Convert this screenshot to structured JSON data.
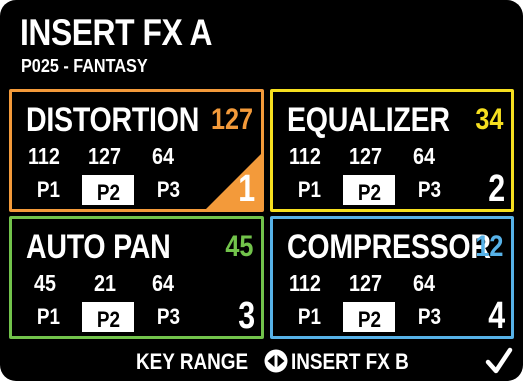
{
  "header": {
    "title": "INSERT FX A",
    "subtitle": "P025 - FANTASY"
  },
  "slots": [
    {
      "name": "DISTORTION",
      "level": "127",
      "params": [
        "112",
        "127",
        "64"
      ],
      "param_labels": [
        "P1",
        "P2",
        "P3"
      ],
      "selected_param": "P2",
      "number": "1",
      "color": "#f39a3a",
      "active": true
    },
    {
      "name": "EQUALIZER",
      "level": "34",
      "params": [
        "112",
        "127",
        "64"
      ],
      "param_labels": [
        "P1",
        "P2",
        "P3"
      ],
      "selected_param": "P2",
      "number": "2",
      "color": "#f6df1f",
      "active": false
    },
    {
      "name": "AUTO PAN",
      "level": "45",
      "params": [
        "45",
        "21",
        "64"
      ],
      "param_labels": [
        "P1",
        "P2",
        "P3"
      ],
      "selected_param": "P2",
      "number": "3",
      "color": "#72c34b",
      "active": false
    },
    {
      "name": "COMPRESSOR",
      "level": "12",
      "params": [
        "112",
        "127",
        "64"
      ],
      "param_labels": [
        "P1",
        "P2",
        "P3"
      ],
      "selected_param": "P2",
      "number": "4",
      "color": "#57b2e8",
      "active": false
    }
  ],
  "footer": {
    "left_label": "KEY RANGE",
    "right_label": "INSERT FX B",
    "nav_icon": "left-right-arrows-icon",
    "confirm_icon": "checkmark-icon"
  }
}
